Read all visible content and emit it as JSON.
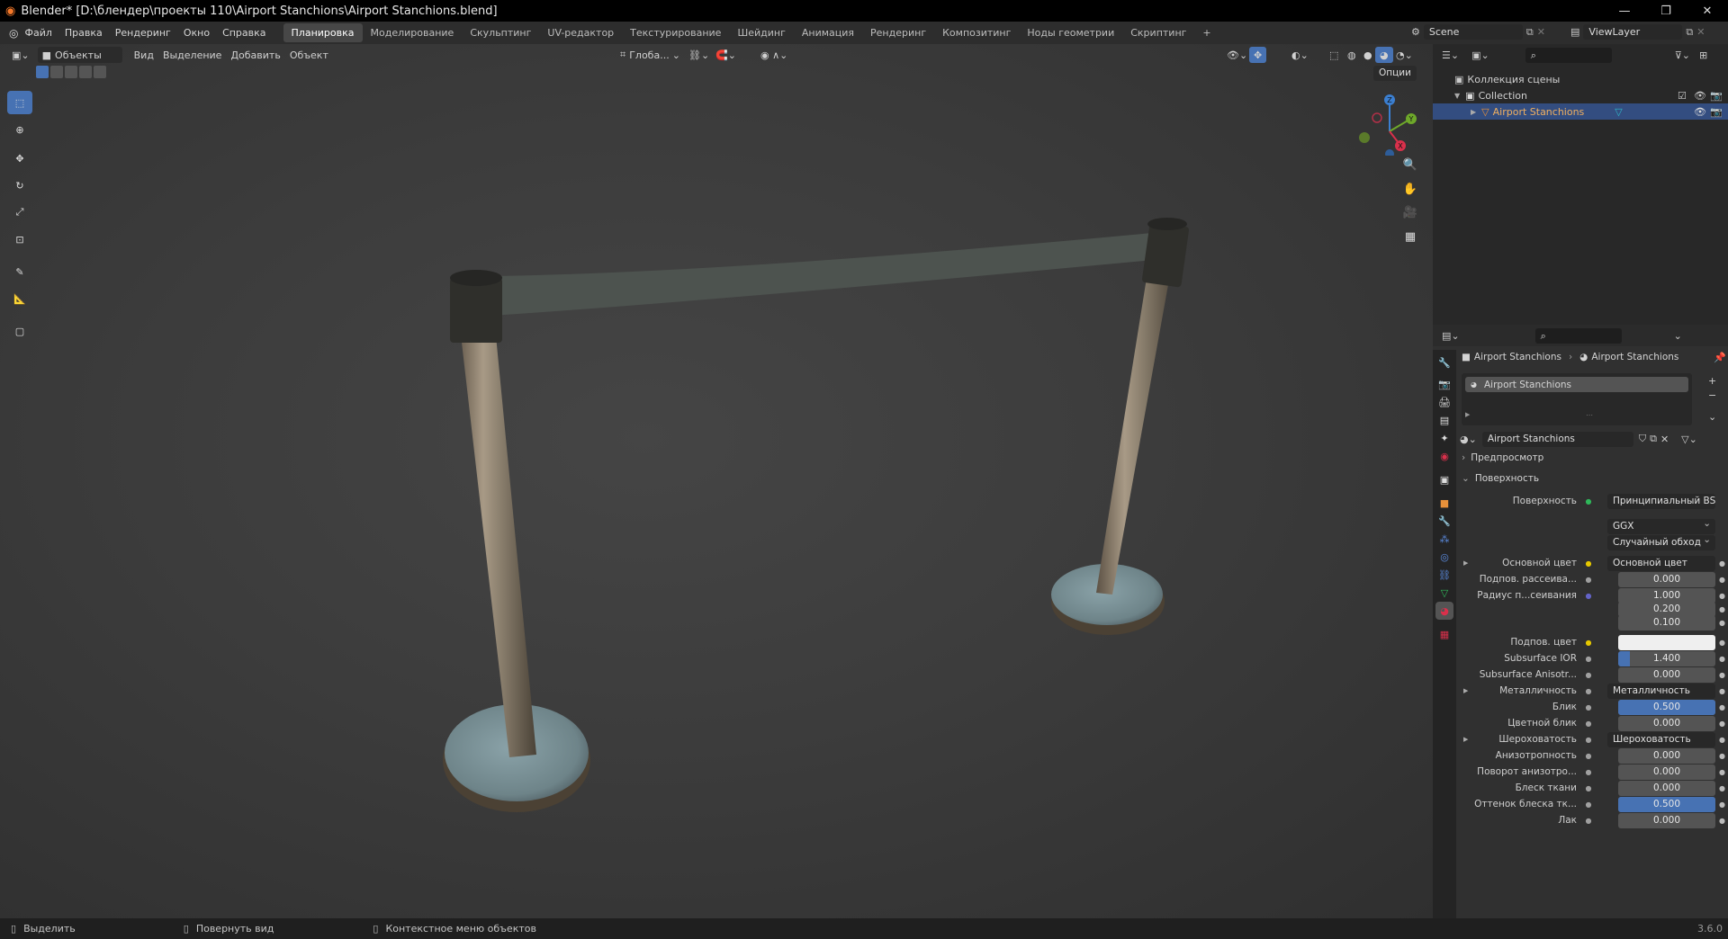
{
  "window": {
    "title": "Blender* [D:\\блендер\\проекты 110\\Airport Stanchions\\Airport Stanchions.blend]",
    "minimize": "—",
    "maximize": "❐",
    "close": "✕"
  },
  "menu": [
    "Файл",
    "Правка",
    "Рендеринг",
    "Окно",
    "Справка"
  ],
  "workspaces": [
    "Планировка",
    "Моделирование",
    "Скульптинг",
    "UV-редактор",
    "Текстурирование",
    "Шейдинг",
    "Анимация",
    "Рендеринг",
    "Композитинг",
    "Ноды геометрии",
    "Скриптинг",
    "+"
  ],
  "active_workspace": "Планировка",
  "scene": {
    "name": "Scene",
    "view_layer": "ViewLayer"
  },
  "viewport_header": {
    "mode": "Объекты",
    "menus": [
      "Вид",
      "Выделение",
      "Добавить",
      "Объект"
    ],
    "transform_orientation": "Глоба...",
    "options": "Опции"
  },
  "gizmo": {
    "z": "Z",
    "y": "Y",
    "x": "X"
  },
  "outliner": {
    "scene_collection": "Коллекция сцены",
    "collection": "Collection",
    "object": "Airport Stanchions"
  },
  "properties": {
    "breadcrumb_object": "Airport Stanchions",
    "breadcrumb_material": "Airport Stanchions",
    "slot": "Airport Stanchions",
    "material_name": "Airport Stanchions",
    "panel_preview": "Предпросмотр",
    "panel_surface": "Поверхность",
    "surface_label": "Поверхность",
    "surface_value": "Принципиальный BSDF",
    "distribution": "GGX",
    "subsurface_method": "Случайный обход",
    "rows": [
      {
        "label": "Основной цвет",
        "type": "link",
        "value": "Основной цвет",
        "expand": true,
        "dot": "#e6c800"
      },
      {
        "label": "Подпов. рассеива...",
        "type": "num",
        "value": "0.000",
        "fill": 0
      },
      {
        "label": "Радиус п...сеивания",
        "type": "num",
        "value": "1.000",
        "fill": 0,
        "dot": "#6363c7"
      },
      {
        "label": "",
        "type": "num",
        "value": "0.200",
        "fill": 0,
        "nodot": true
      },
      {
        "label": "",
        "type": "num",
        "value": "0.100",
        "fill": 0,
        "nodot": true
      },
      {
        "label": "Подпов. цвет",
        "type": "color",
        "value": "",
        "dot": "#e6c800"
      },
      {
        "label": "Subsurface IOR",
        "type": "num",
        "value": "1.400",
        "fill": 0.12
      },
      {
        "label": "Subsurface Anisotr...",
        "type": "num",
        "value": "0.000",
        "fill": 0
      },
      {
        "label": "Металличность",
        "type": "link",
        "value": "Металличность",
        "expand": true
      },
      {
        "label": "Блик",
        "type": "num",
        "value": "0.500",
        "fill": 1
      },
      {
        "label": "Цветной блик",
        "type": "num",
        "value": "0.000",
        "fill": 0
      },
      {
        "label": "Шероховатость",
        "type": "link",
        "value": "Шероховатость",
        "expand": true
      },
      {
        "label": "Анизотропность",
        "type": "num",
        "value": "0.000",
        "fill": 0
      },
      {
        "label": "Поворот анизотро...",
        "type": "num",
        "value": "0.000",
        "fill": 0
      },
      {
        "label": "Блеск ткани",
        "type": "num",
        "value": "0.000",
        "fill": 0
      },
      {
        "label": "Оттенок блеска тк...",
        "type": "num",
        "value": "0.500",
        "fill": 1
      },
      {
        "label": "Лак",
        "type": "num",
        "value": "0.000",
        "fill": 0
      }
    ]
  },
  "status": {
    "select": "Выделить",
    "rotate": "Повернуть вид",
    "context": "Контекстное меню объектов",
    "version": "3.6.0"
  },
  "colors": {
    "accent": "#4772b3",
    "header": "#2d2d2d",
    "panel": "#303030"
  }
}
